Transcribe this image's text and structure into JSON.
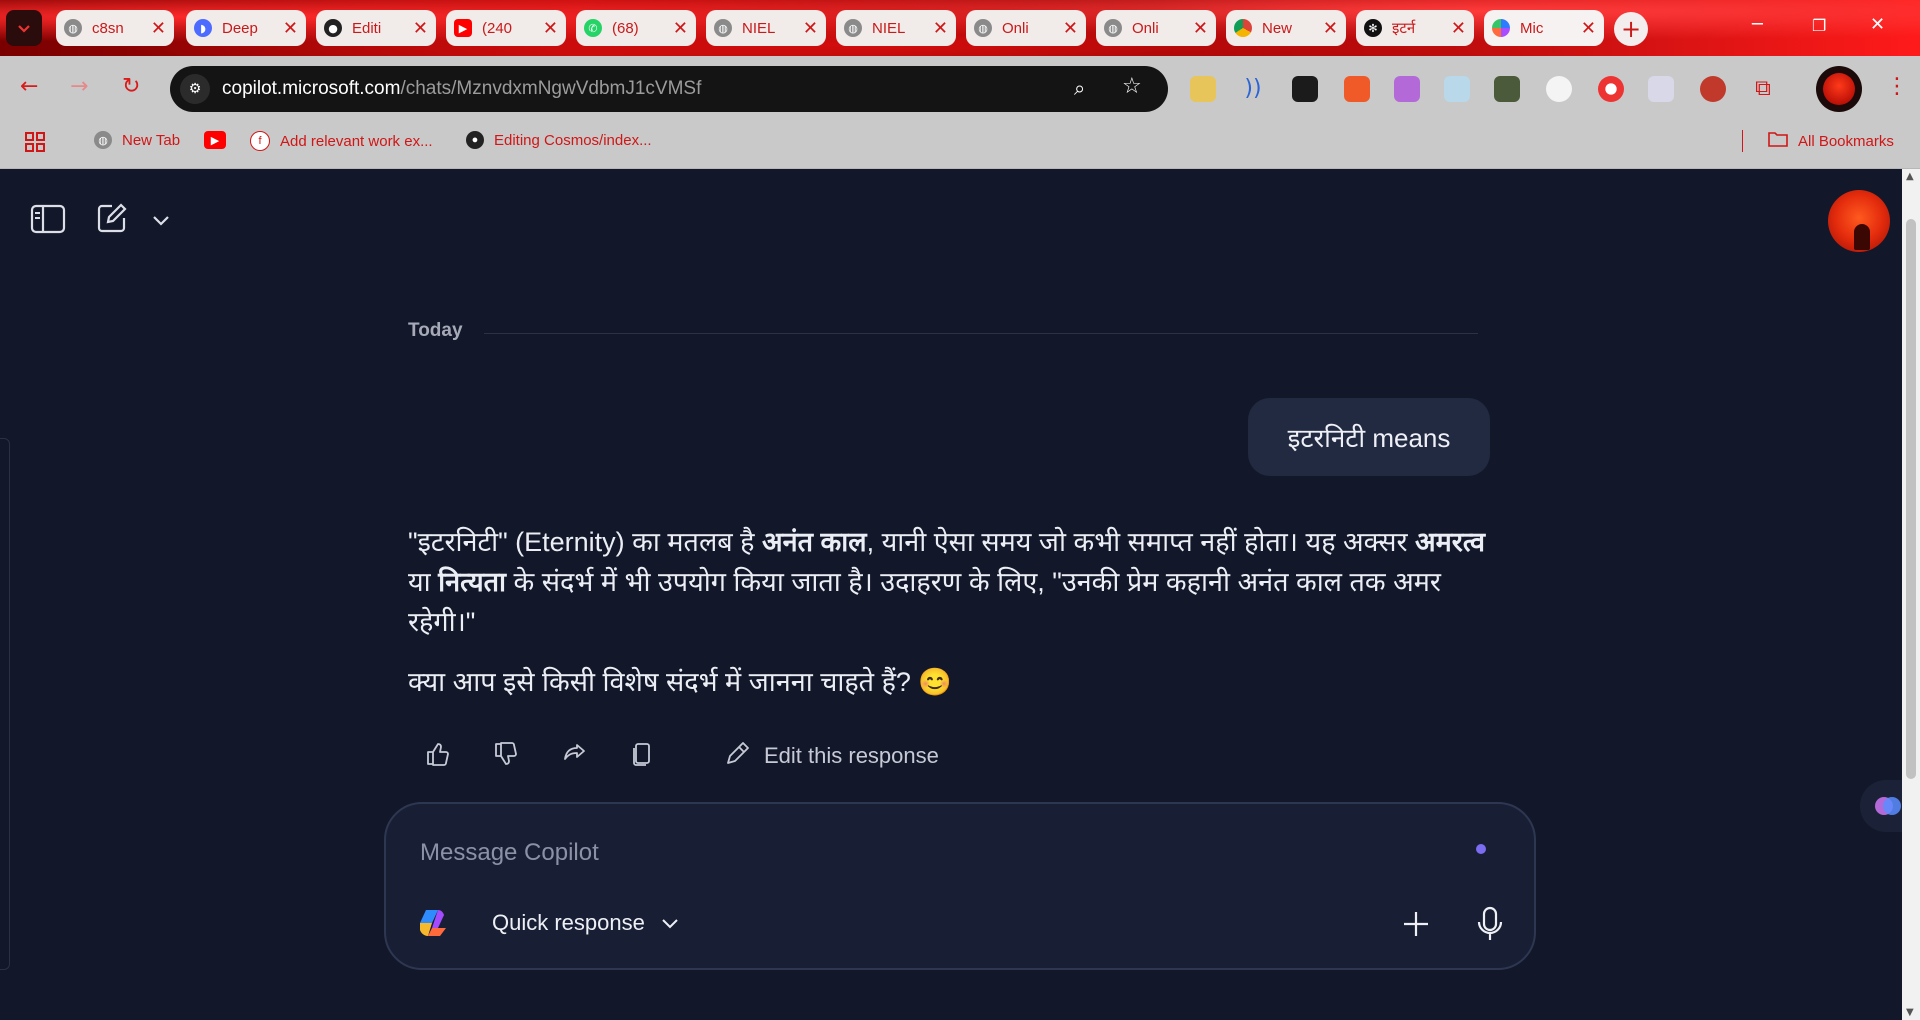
{
  "browser": {
    "tabs": [
      {
        "title": "c8sn",
        "favicon": "globe-icon",
        "color": "#7d7d7d"
      },
      {
        "title": "Deep",
        "favicon": "deepseek-icon",
        "color": "#4d6bfe"
      },
      {
        "title": "Editi",
        "favicon": "github-icon",
        "color": "#222222"
      },
      {
        "title": "(240",
        "favicon": "youtube-icon",
        "color": "#ff0000"
      },
      {
        "title": "(68)",
        "favicon": "whatsapp-icon",
        "color": "#25d366"
      },
      {
        "title": "NIEL",
        "favicon": "globe-icon",
        "color": "#7d7d7d"
      },
      {
        "title": "NIEL",
        "favicon": "globe-icon",
        "color": "#7d7d7d"
      },
      {
        "title": "Onli",
        "favicon": "globe-icon",
        "color": "#7d7d7d"
      },
      {
        "title": "Onli",
        "favicon": "globe-icon",
        "color": "#7d7d7d"
      },
      {
        "title": "New",
        "favicon": "chrome-icon",
        "color": "#db4437"
      },
      {
        "title": "इटर्न",
        "favicon": "chatgpt-icon",
        "color": "#111111"
      },
      {
        "title": "Mic",
        "favicon": "copilot-icon",
        "color": "#6a5cff",
        "active": true
      }
    ],
    "url_domain": "copilot.microsoft.com",
    "url_path": "/chats/MznvdxmNgwVdbmJ1cVMSf",
    "bookmarks": [
      {
        "label": "New Tab",
        "icon": "globe-icon"
      },
      {
        "label": "",
        "icon": "youtube-icon"
      },
      {
        "label": "Add relevant work ex...",
        "icon": "facebook-icon"
      },
      {
        "label": "Editing Cosmos/index...",
        "icon": "github-icon"
      }
    ],
    "all_bookmarks": "All Bookmarks",
    "accent": "#d01616"
  },
  "chat": {
    "date_divider": "Today",
    "user_message": "इटरनिटी  means",
    "answer_p1_a": "\"इटरनिटी\" (Eternity) का मतलब है ",
    "answer_p1_b": "अनंत काल",
    "answer_p1_c": ", यानी ऐसा समय जो कभी समाप्त नहीं होता। यह अक्सर ",
    "answer_p1_d": "अमरत्व",
    "answer_p1_e": " या ",
    "answer_p1_f": "नित्यता",
    "answer_p1_g": " के संदर्भ में भी उपयोग किया जाता है। उदाहरण के लिए, \"उनकी प्रेम कहानी अनंत काल तक अमर रहेगी।\"",
    "answer_p2": "क्या आप इसे किसी विशेष संदर्भ में जानना चाहते हैं? 😊",
    "edit_response": "Edit this response"
  },
  "composer": {
    "placeholder": "Message Copilot",
    "mode": "Quick response"
  },
  "colors": {
    "page_bg": "#121829",
    "bubble_bg": "#222a42",
    "composer_bg": "#181f34"
  }
}
